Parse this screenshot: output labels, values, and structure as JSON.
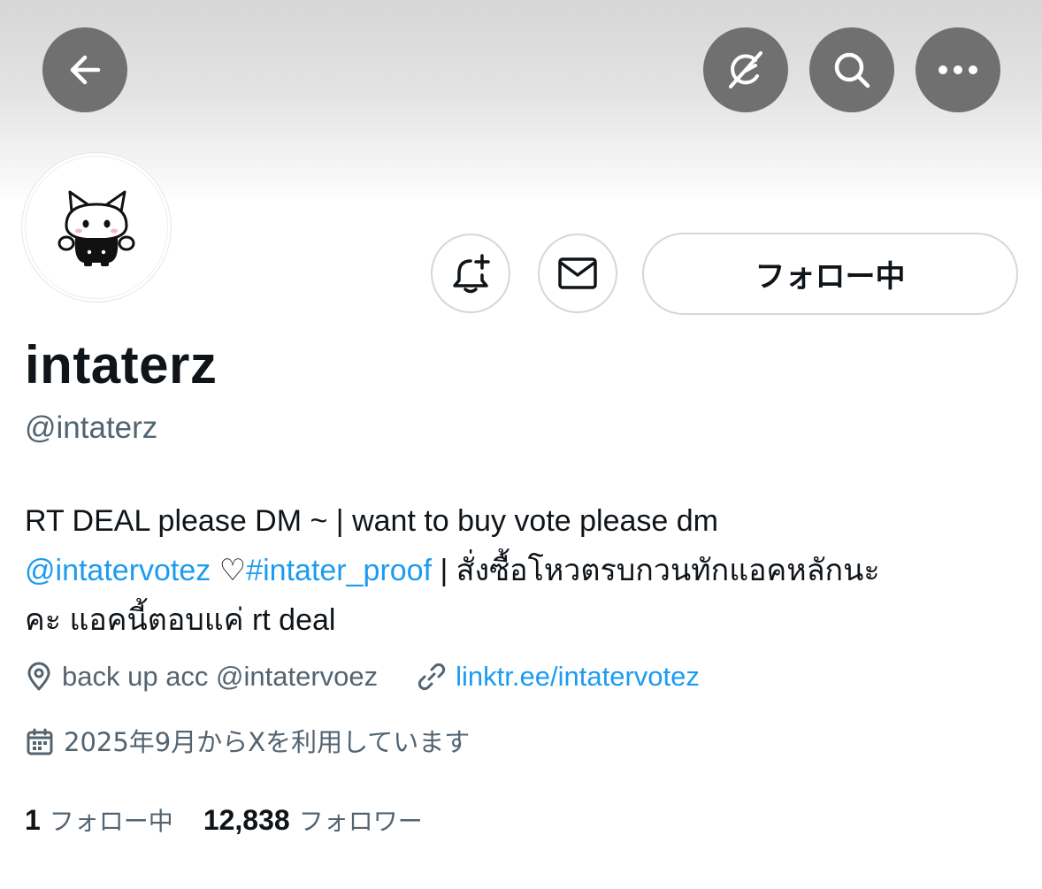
{
  "colors": {
    "link": "#1d9bf0",
    "secondary_text": "#536471",
    "primary_text": "#0f1419",
    "header_button_bg": "#707070",
    "outline_border": "#cfd9de"
  },
  "header": {
    "back_icon": "arrow-left-icon",
    "grok_icon": "grok-icon",
    "search_icon": "search-icon",
    "more_icon": "more-horizontal-icon"
  },
  "profile": {
    "avatar_icon": "cat-avatar",
    "display_name": "intaterz",
    "handle": "@intaterz",
    "following_button_label": "フォロー中",
    "notify_icon": "bell-plus-icon",
    "message_icon": "envelope-icon",
    "bio": {
      "line1": "RT DEAL please DM ~ | want to buy vote please dm",
      "mention": "@intatervotez",
      "heart": " ♡",
      "hashtag": "#intater_proof",
      "line2_rest": " | สั่งซื้อโหวตรบกวนทักแอคหลักนะ",
      "line3": "คะ แอคนี้ตอบแค่ rt deal"
    },
    "location": "back up acc @intatervoez",
    "location_icon": "location-pin-icon",
    "website": "linktr.ee/intatervotez",
    "website_icon": "link-icon",
    "joined": "2025年9月からXを利用しています",
    "joined_icon": "calendar-icon",
    "following_count": "1",
    "following_label": "フォロー中",
    "followers_count": "12,838",
    "followers_label": "フォロワー"
  }
}
